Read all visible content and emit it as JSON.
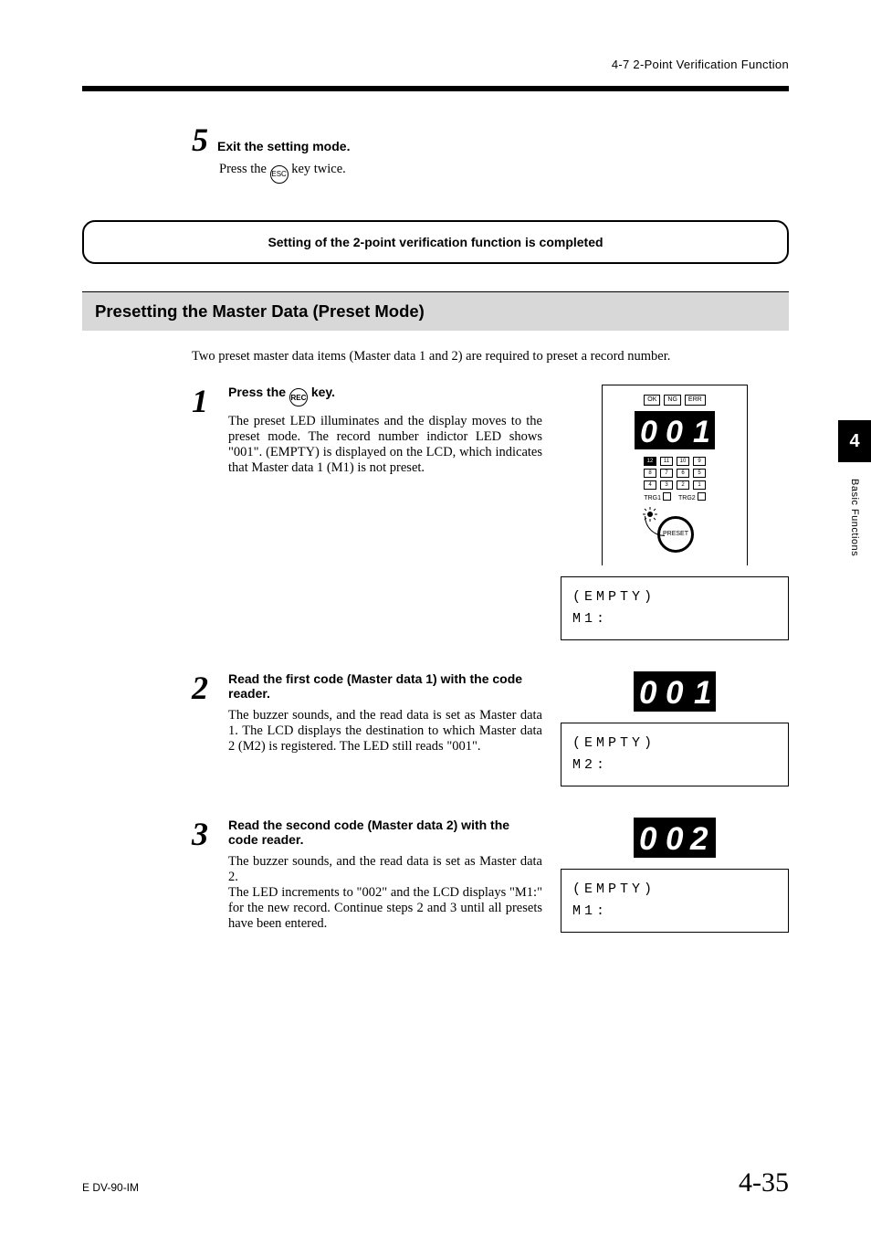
{
  "header": {
    "breadcrumb": "4-7  2-Point Verification Function"
  },
  "step5": {
    "num": "5",
    "title": "Exit the setting mode.",
    "body_pre": "Press the ",
    "key": "ESC",
    "body_post": " key twice."
  },
  "completion": "Setting of the 2-point verification function is completed",
  "section": "Presetting the Master Data (Preset Mode)",
  "intro": "Two preset master data items (Master data 1 and 2) are required to preset a record number.",
  "steps": [
    {
      "num": "1",
      "title_pre": "Press the ",
      "key": "REC",
      "title_post": " key.",
      "para": "The preset LED illuminates and the display moves to the preset mode. The record number indictor LED shows \"001\". (EMPTY) is displayed on the LCD, which indicates that Master data 1 (M1) is not preset.",
      "led": "001",
      "lcd": {
        "line1": "(EMPTY)",
        "line2": "M1:"
      },
      "panel": true
    },
    {
      "num": "2",
      "title": "Read the first code (Master data 1) with the code reader.",
      "para": "The buzzer sounds, and the read data is set as Master data 1. The LCD displays the destination to which Master data 2 (M2) is registered. The LED still reads \"001\".",
      "led": "001",
      "lcd": {
        "line1": "(EMPTY)",
        "line2": "M2:"
      }
    },
    {
      "num": "3",
      "title": "Read the second code (Master data 2) with the code reader.",
      "para": "The buzzer sounds, and the read data is set as Master data 2.\nThe LED increments to \"002\" and the LCD displays \"M1:\" for the new record. Continue steps 2 and 3 until all presets have been entered.",
      "led": "002",
      "lcd": {
        "line1": "(EMPTY)",
        "line2": "M1:"
      }
    }
  ],
  "panel": {
    "status": [
      "OK",
      "NG",
      "ERR"
    ],
    "row1": [
      "12",
      "11",
      "10",
      "9"
    ],
    "row2": [
      "8",
      "7",
      "6",
      "5"
    ],
    "row3": [
      "4",
      "3",
      "2",
      "1"
    ],
    "trg": [
      "TRG1",
      "TRG2"
    ],
    "preset": "PRESET"
  },
  "sidetab": {
    "num": "4",
    "label": "Basic Functions"
  },
  "footer": {
    "left": "E DV-90-IM",
    "right": "4-35"
  }
}
